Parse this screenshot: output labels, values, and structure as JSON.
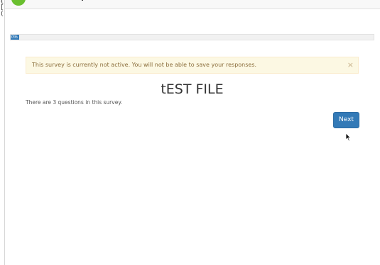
{
  "progress": {
    "label": "0%",
    "value": 0
  },
  "alert": {
    "message": "This survey is currently not active. You will not be able to save your responses.",
    "close_symbol": "×"
  },
  "survey": {
    "title": "tEST FILE",
    "question_count_text": "There are 3 questions in this survey."
  },
  "navigation": {
    "next_label": "Next"
  },
  "icons": {
    "logo": "green-circle-logo-icon",
    "cursor": "mouse-pointer-icon",
    "close": "close-icon"
  },
  "colors": {
    "primary": "#337ab7",
    "alert_bg": "#fcf8e3",
    "alert_text": "#8a6d3b",
    "logo_green": "#6abf2f"
  }
}
